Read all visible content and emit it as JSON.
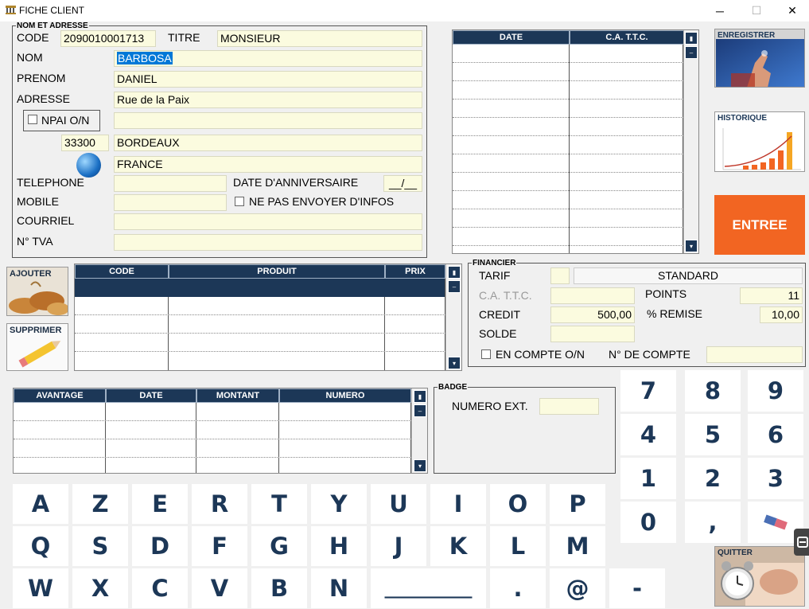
{
  "window": {
    "title": "FICHE CLIENT",
    "minimize": "─",
    "maximize": "☐",
    "close": "✕"
  },
  "client": {
    "legend": "NOM ET ADRESSE",
    "code_label": "CODE",
    "code_value": "2090010001713",
    "titre_label": "TITRE",
    "titre_value": "MONSIEUR",
    "nom_label": "NOM",
    "nom_value": "BARBOSA",
    "prenom_label": "PRENOM",
    "prenom_value": "DANIEL",
    "adresse_label": "ADRESSE",
    "adresse_value": "Rue de la Paix",
    "adresse2_value": "",
    "npai_label": "NPAI O/N",
    "cp_value": "33300",
    "ville_value": "BORDEAUX",
    "pays_value": "FRANCE",
    "telephone_label": "TELEPHONE",
    "telephone_value": "",
    "anniversaire_label": "DATE D'ANNIVERSAIRE",
    "anniversaire_value": "__/__",
    "mobile_label": "MOBILE",
    "mobile_value": "",
    "ne_pas_envoyer_label": "NE PAS ENVOYER D'INFOS",
    "courriel_label": "COURRIEL",
    "courriel_value": "",
    "tva_label": "N° TVA",
    "tva_value": ""
  },
  "ventes_grid": {
    "headers": [
      "DATE",
      "C.A. T.T.C."
    ]
  },
  "produits_grid": {
    "headers": [
      "CODE",
      "PRODUIT",
      "PRIX"
    ]
  },
  "avantages_grid": {
    "headers": [
      "AVANTAGE",
      "DATE",
      "MONTANT",
      "NUMERO"
    ]
  },
  "buttons": {
    "enregistrer": "ENREGISTRER",
    "historique": "HISTORIQUE",
    "entree": "ENTREE",
    "ajouter": "AJOUTER",
    "supprimer": "SUPPRIMER",
    "quitter": "QUITTER"
  },
  "financier": {
    "legend": "FINANCIER",
    "tarif_label": "TARIF",
    "tarif_code": "",
    "tarif_value": "STANDARD",
    "ca_label": "C.A. T.T.C.",
    "ca_value": "",
    "points_label": "POINTS",
    "points_value": "11",
    "credit_label": "CREDIT",
    "credit_value": "500,00",
    "remise_label": "% REMISE",
    "remise_value": "10,00",
    "solde_label": "SOLDE",
    "solde_value": "",
    "en_compte_label": "EN COMPTE O/N",
    "num_compte_label": "N° DE COMPTE",
    "num_compte_value": ""
  },
  "badge": {
    "legend": "BADGE",
    "numero_label": "NUMERO EXT.",
    "numero_value": ""
  },
  "keypad": {
    "keys": [
      "7",
      "8",
      "9",
      "4",
      "5",
      "6",
      "1",
      "2",
      "3",
      "0",
      ","
    ]
  },
  "keyboard": {
    "row1": [
      "A",
      "Z",
      "E",
      "R",
      "T",
      "Y",
      "U",
      "I",
      "O",
      "P"
    ],
    "row2": [
      "Q",
      "S",
      "D",
      "F",
      "G",
      "H",
      "J",
      "K",
      "L",
      "M"
    ],
    "row3": [
      "W",
      "X",
      "C",
      "V",
      "B",
      "N",
      "__________",
      ".",
      "@",
      "-"
    ]
  },
  "colors": {
    "header": "#1c3757",
    "field": "#fbfbdf",
    "entree": "#f26522"
  }
}
